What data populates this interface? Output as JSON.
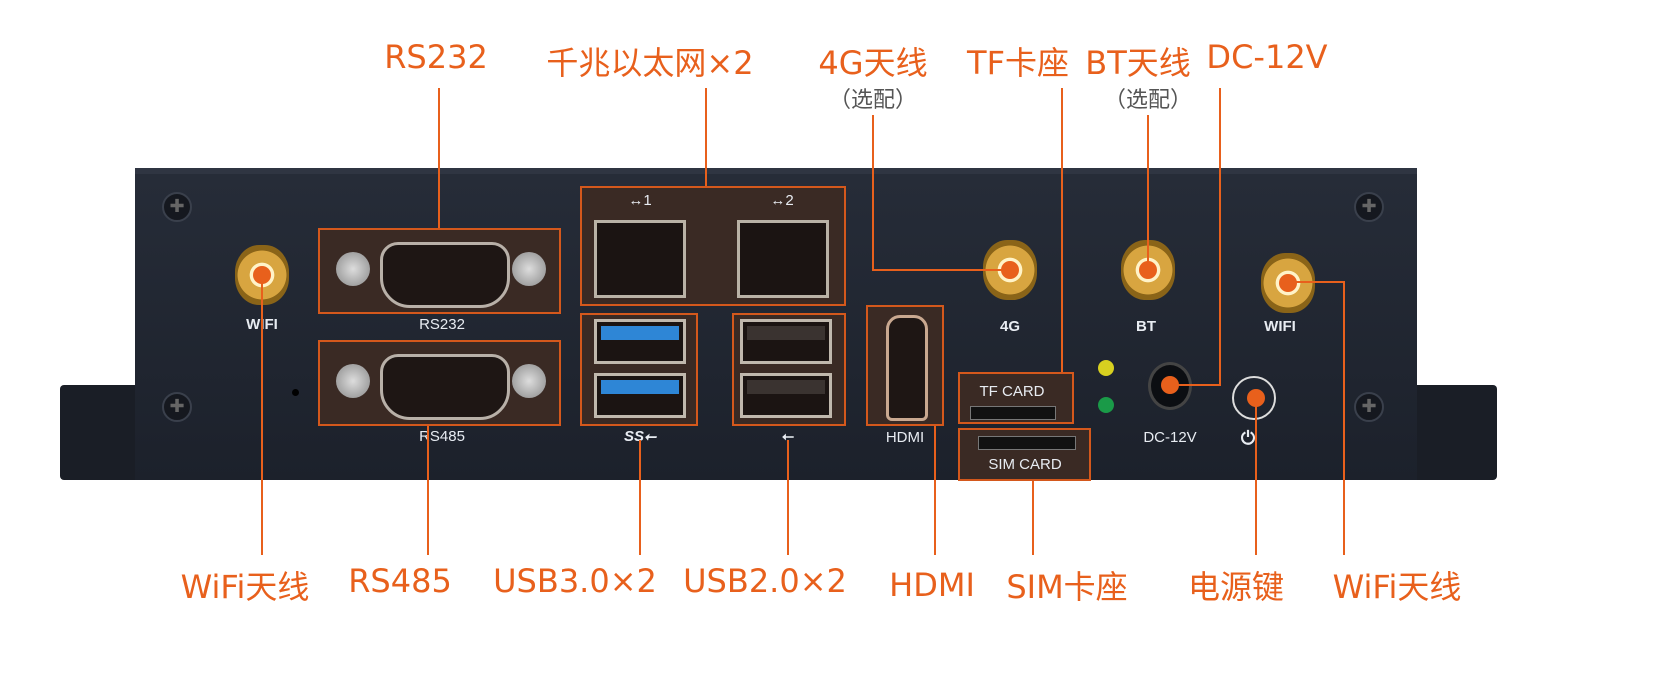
{
  "colors": {
    "accent": "#e8601c",
    "device": "#1e2430"
  },
  "top_callouts": [
    {
      "label": "RS232",
      "note": ""
    },
    {
      "label": "千兆以太网×2",
      "note": ""
    },
    {
      "label": "4G天线",
      "note": "（选配）"
    },
    {
      "label": "TF卡座",
      "note": ""
    },
    {
      "label": "BT天线",
      "note": "（选配）"
    },
    {
      "label": "DC-12V",
      "note": ""
    }
  ],
  "bottom_callouts": [
    {
      "label": "WiFi天线"
    },
    {
      "label": "RS485"
    },
    {
      "label": "USB3.0×2"
    },
    {
      "label": "USB2.0×2"
    },
    {
      "label": "HDMI"
    },
    {
      "label": "SIM卡座"
    },
    {
      "label": "电源键"
    },
    {
      "label": "WiFi天线"
    }
  ],
  "device_labels": {
    "wifi_left": "WIFI",
    "rs232": "RS232",
    "rs485": "RS485",
    "lan1": "↔1",
    "lan2": "↔2",
    "usb3": "SS⭠",
    "usb2": "⭠",
    "hdmi": "HDMI",
    "tf": "TF CARD",
    "sim": "SIM CARD",
    "antenna_4g": "4G",
    "antenna_bt": "BT",
    "wifi_right": "WIFI",
    "dc": "DC-12V",
    "power": "⏻"
  }
}
